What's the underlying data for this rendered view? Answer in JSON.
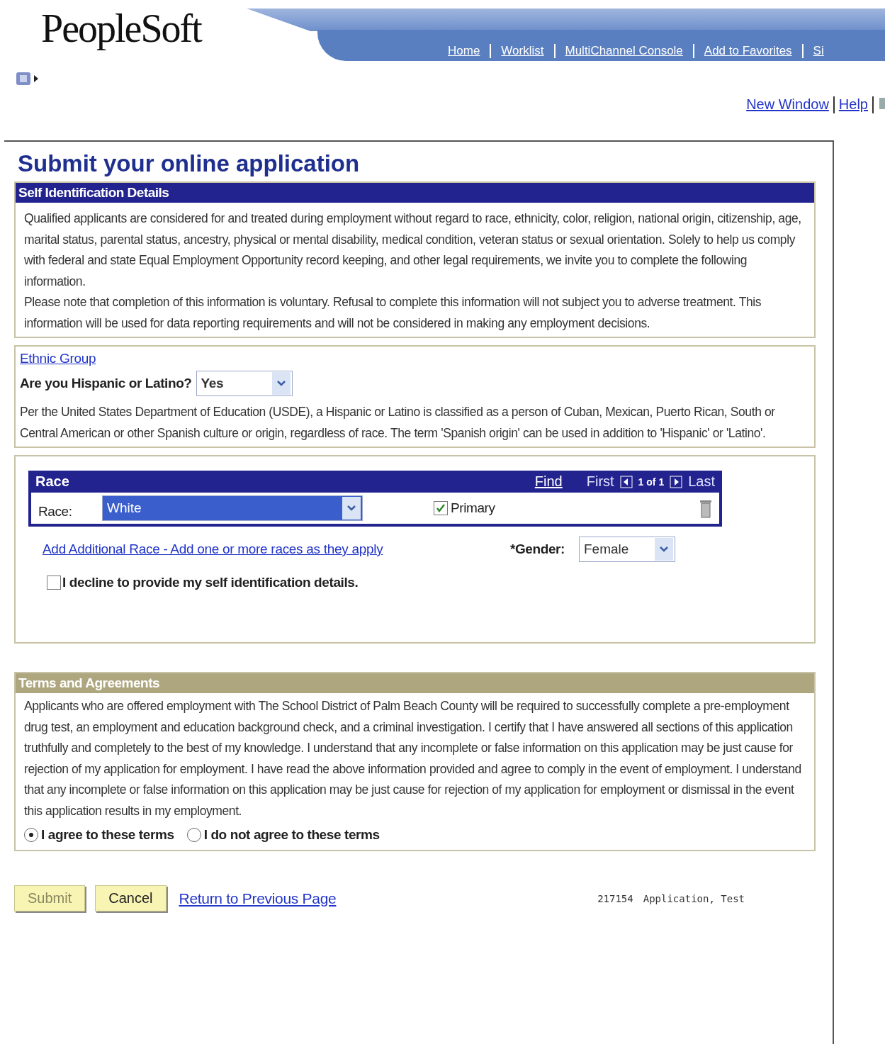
{
  "header": {
    "logo": "PeopleSoft",
    "nav_links": [
      "Home",
      "Worklist",
      "MultiChannel Console",
      "Add to Favorites",
      "Si"
    ],
    "util_links": [
      "New Window",
      "Help"
    ]
  },
  "page_title": "Submit your online application",
  "self_id": {
    "header": "Self Identification Details",
    "paragraphs": [
      "Qualified applicants are considered for and treated during employment without regard to race, ethnicity, color, religion, national origin, citizenship, age, marital status, parental status, ancestry, physical or mental disability, medical condition, veteran status or sexual orientation. Solely to help us comply with federal and state Equal Employment Opportunity record keeping, and other legal requirements, we invite you to complete the following information.",
      "Please note that completion of this information is voluntary. Refusal to complete this information will not subject you to adverse treatment. This information will be used for data reporting requirements and will not be considered in making any employment decisions."
    ]
  },
  "ethnic": {
    "link": "Ethnic Group",
    "question": "Are you Hispanic or Latino?",
    "value": "Yes",
    "note": "Per the United States Department of Education (USDE), a Hispanic or Latino is classified as a person of Cuban, Mexican, Puerto Rican, South or Central American or other Spanish culture or origin, regardless of race. The term 'Spanish origin' can be used in addition to 'Hispanic' or 'Latino'."
  },
  "race": {
    "header": "Race",
    "find": "Find",
    "first": "First",
    "count": "1 of 1",
    "last": "Last",
    "label": "Race:",
    "value": "White",
    "primary": {
      "label": "Primary",
      "checked": true
    },
    "add_link": "Add Additional Race - Add one or more races as they apply",
    "gender_label": "*Gender:",
    "gender_value": "Female",
    "decline": {
      "label": "I decline to provide my self identification details.",
      "checked": false
    }
  },
  "terms": {
    "header": "Terms and Agreements",
    "text": "Applicants who are offered employment with The School District of Palm Beach County will be required to successfully complete a pre-employment drug test, an employment and education background check, and a criminal investigation. I certify that I have answered all sections of this application truthfully and completely to the best of my knowledge.  I understand that any incomplete or false information on this application may be just cause for rejection of my application for employment. I have read the above information provided and agree to comply in the event of employment. I understand that any incomplete or false information on this application may be just cause for rejection of my application for employment or dismissal in the event this application results in my employment.",
    "options": [
      {
        "label": "I agree to these terms",
        "selected": true
      },
      {
        "label": "I do not agree to these terms",
        "selected": false
      }
    ]
  },
  "buttons": [
    {
      "label": "Submit",
      "disabled": true
    },
    {
      "label": "Cancel",
      "disabled": false
    }
  ],
  "return_link": "Return to Previous Page",
  "footer": {
    "id": "217154",
    "name": "Application, Test"
  }
}
